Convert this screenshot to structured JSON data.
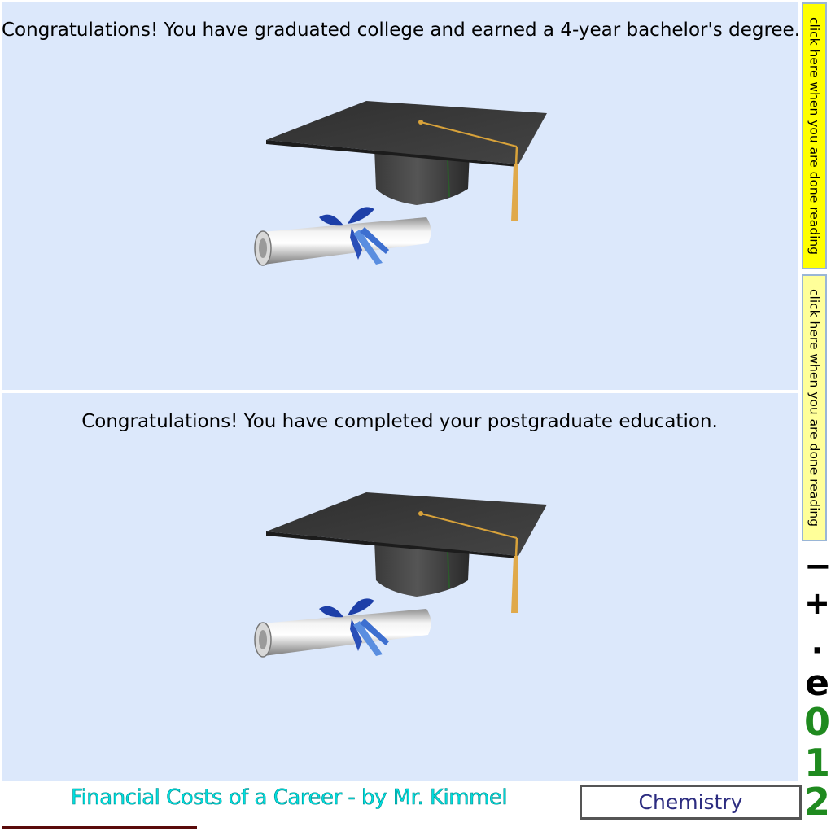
{
  "panels": [
    {
      "message": "Congratulations! You have graduated college and earned a 4-year bachelor's degree.",
      "done_button": "click here when you are done reading"
    },
    {
      "message": "Congratulations! You have completed your postgraduate education.",
      "done_button": "click here when you are done reading"
    }
  ],
  "keypad": {
    "minus": "−",
    "plus": "+",
    "dot": "·",
    "e": "e",
    "zero": "0",
    "one": "1",
    "two": "2"
  },
  "footer": {
    "title": "Financial Costs of a Career - by Mr. Kimmel",
    "subject": "Chemistry"
  },
  "colors": {
    "panel_bg": "#dce8fb",
    "done_active": "#ffff00",
    "done_inactive": "#ffff99",
    "title": "#00e0e0",
    "digits": "#1f8a1f"
  },
  "icons": [
    "graduation-cap-icon",
    "diploma-scroll-icon"
  ]
}
